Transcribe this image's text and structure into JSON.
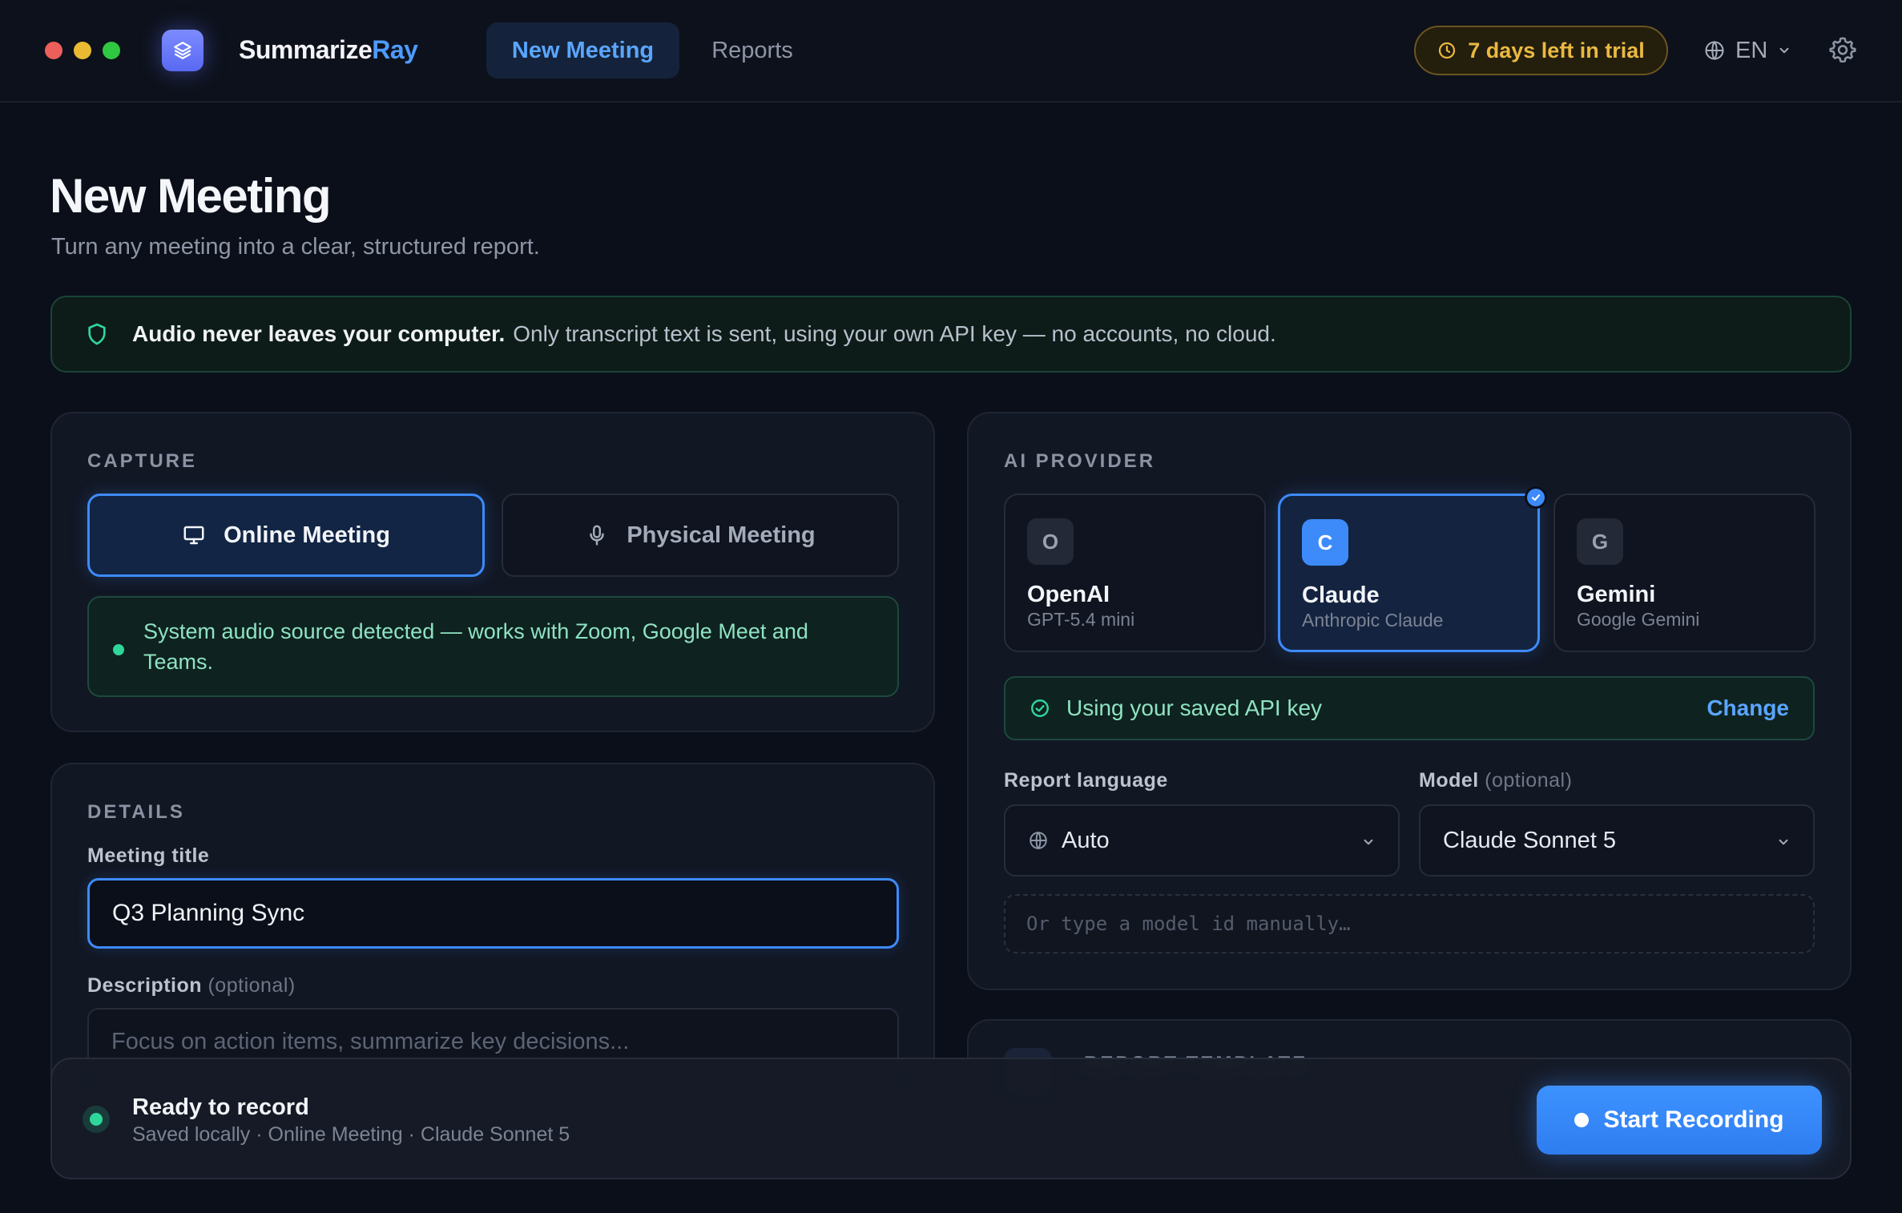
{
  "app": {
    "brand_main": "Summarize",
    "brand_accent": "Ray",
    "accent_color": "#3d8bfa"
  },
  "nav": {
    "tabs": [
      {
        "label": "New Meeting",
        "active": true
      },
      {
        "label": "Reports",
        "active": false
      }
    ]
  },
  "header": {
    "trial_label": "7 days left in trial",
    "language": "EN"
  },
  "page": {
    "title": "New Meeting",
    "subtitle": "Turn any meeting into a clear, structured report."
  },
  "privacy": {
    "strong": "Audio never leaves your computer.",
    "rest": "Only transcript text is sent, using your own API key — no accounts, no cloud."
  },
  "capture": {
    "label": "CAPTURE",
    "modes": [
      {
        "label": "Online Meeting",
        "icon": "monitor-icon",
        "selected": true
      },
      {
        "label": "Physical Meeting",
        "icon": "microphone-icon",
        "selected": false
      }
    ],
    "note": "System audio source detected — works with Zoom, Google Meet and Teams."
  },
  "details": {
    "label": "DETAILS",
    "title_label": "Meeting title",
    "title_value": "Q3 Planning Sync",
    "description_label": "Description",
    "description_optional": "(optional)",
    "description_placeholder": "Focus on action items, summarize key decisions..."
  },
  "provider": {
    "label": "AI PROVIDER",
    "options": [
      {
        "badge": "O",
        "name": "OpenAI",
        "sub": "GPT-5.4 mini",
        "selected": false
      },
      {
        "badge": "C",
        "name": "Claude",
        "sub": "Anthropic Claude",
        "selected": true
      },
      {
        "badge": "G",
        "name": "Gemini",
        "sub": "Google Gemini",
        "selected": false
      }
    ],
    "api_text": "Using your saved API key",
    "api_change": "Change",
    "report_language_label": "Report language",
    "report_language_value": "Auto",
    "model_label": "Model",
    "model_optional": "(optional)",
    "model_value": "Claude Sonnet 5",
    "manual_placeholder": "Or type a model id manually…"
  },
  "template": {
    "label": "REPORT TEMPLATE"
  },
  "bottom": {
    "status": "Ready to record",
    "status_sub": "Saved locally · Online Meeting · Claude Sonnet 5",
    "record_label": "Start Recording"
  }
}
